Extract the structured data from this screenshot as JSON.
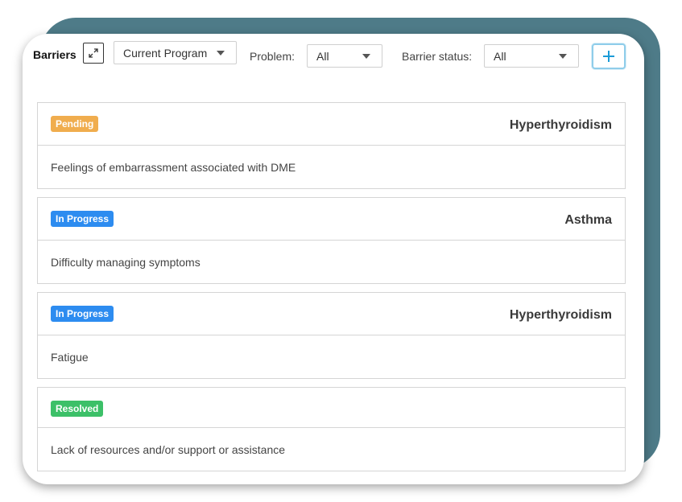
{
  "header": {
    "title": "Barriers",
    "program_select": "Current Program",
    "problem_label": "Problem:",
    "problem_value": "All",
    "status_label": "Barrier status:",
    "status_value": "All",
    "add_label": "+"
  },
  "colors": {
    "backdrop": "#4e7b88",
    "pending": "#f0ad4e",
    "in_progress": "#2d8cf0",
    "resolved": "#3cc068",
    "add_accent": "#1a9bd7"
  },
  "barriers": [
    {
      "status": "Pending",
      "problem": "Hyperthyroidism",
      "description": "Feelings of embarrassment associated with DME"
    },
    {
      "status": "In Progress",
      "problem": "Asthma",
      "description": "Difficulty managing symptoms"
    },
    {
      "status": "In Progress",
      "problem": "Hyperthyroidism",
      "description": "Fatigue"
    },
    {
      "status": "Resolved",
      "problem": "",
      "description": "Lack of resources and/or support or assistance"
    }
  ]
}
